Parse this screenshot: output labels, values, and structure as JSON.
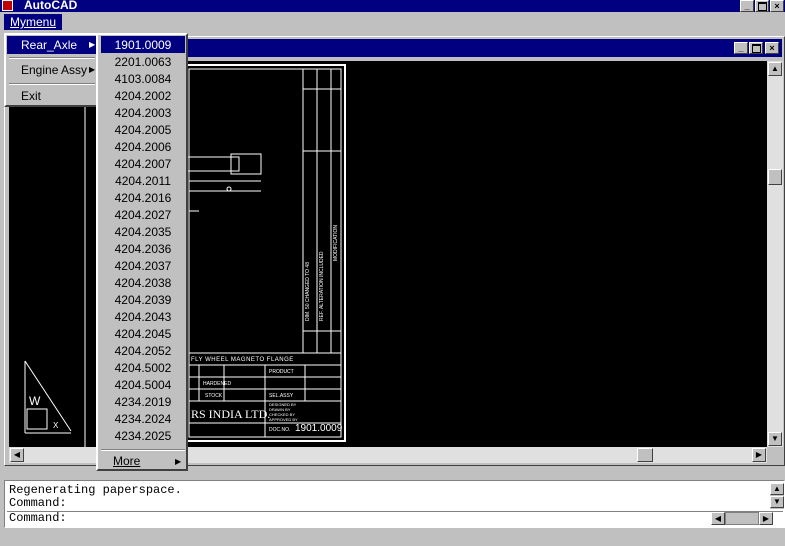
{
  "app": {
    "title": "AutoCAD"
  },
  "menubar": {
    "mymenu_label": "Mymenu"
  },
  "mymenu": {
    "items": [
      {
        "label": "Rear_Axle",
        "has_submenu": true
      },
      {
        "label": "Engine Assy",
        "has_submenu": true
      },
      {
        "label": "Exit",
        "has_submenu": false
      }
    ]
  },
  "submenu": {
    "items": [
      "1901.0009",
      "2201.0063",
      "4103.0084",
      "4204.2002",
      "4204.2003",
      "4204.2005",
      "4204.2006",
      "4204.2007",
      "4204.2011",
      "4204.2016",
      "4204.2027",
      "4204.2035",
      "4204.2036",
      "4204.2037",
      "4204.2038",
      "4204.2039",
      "4204.2043",
      "4204.2045",
      "4204.2052",
      "4204.5002",
      "4204.5004",
      "4234.2019",
      "4234.2024",
      "4234.2025"
    ],
    "selected_index": 0,
    "more_label": "More"
  },
  "drawing": {
    "title_text": "FLY WHEEL MAGNETO FLANGE",
    "company": "RS INDIA LTD.",
    "doc_no_label": "DOC.NO.",
    "doc_no": "1901.0009",
    "cell_stock": "STOCK",
    "cell_hardened": "HARDENED",
    "cell_product": "PRODUCT",
    "cell_sel_assy": "SEL.ASSY",
    "cell_designed_by": "DESIGNED BY",
    "cell_drawn_by": "DRAWN BY",
    "cell_checked_by": "CHECKED BY",
    "cell_approved_by": "APPROVED BY"
  },
  "command": {
    "lines": [
      "Regenerating paperspace.",
      "Command:"
    ],
    "prompt": "Command:"
  },
  "colors": {
    "titlebar": "#000080",
    "canvas": "#000000",
    "chrome": "#c0c0c0"
  }
}
